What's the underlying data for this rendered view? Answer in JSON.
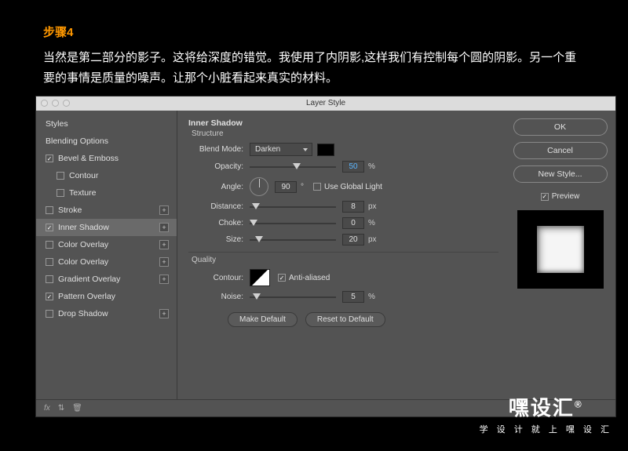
{
  "header": {
    "step_title": "步骤4",
    "description": "当然是第二部分的影子。这将给深度的错觉。我使用了内阴影,这样我们有控制每个圆的阴影。另一个重要的事情是质量的噪声。让那个小脏看起来真实的材料。"
  },
  "dialog": {
    "title": "Layer Style",
    "sidebar": {
      "styles": "Styles",
      "blending": "Blending Options",
      "bevel": "Bevel & Emboss",
      "contour": "Contour",
      "texture": "Texture",
      "stroke": "Stroke",
      "inner_shadow": "Inner Shadow",
      "color_overlay": "Color Overlay",
      "color_overlay2": "Color Overlay",
      "gradient_overlay": "Gradient Overlay",
      "pattern_overlay": "Pattern Overlay",
      "drop_shadow": "Drop Shadow"
    },
    "main": {
      "section": "Inner Shadow",
      "structure": "Structure",
      "blend_mode_label": "Blend Mode:",
      "blend_mode_value": "Darken",
      "opacity_label": "Opacity:",
      "opacity_value": "50",
      "opacity_unit": "%",
      "angle_label": "Angle:",
      "angle_value": "90",
      "angle_unit": "°",
      "global_light": "Use Global Light",
      "distance_label": "Distance:",
      "distance_value": "8",
      "distance_unit": "px",
      "choke_label": "Choke:",
      "choke_value": "0",
      "choke_unit": "%",
      "size_label": "Size:",
      "size_value": "20",
      "size_unit": "px",
      "quality": "Quality",
      "contour_label": "Contour:",
      "anti_aliased": "Anti-aliased",
      "noise_label": "Noise:",
      "noise_value": "5",
      "noise_unit": "%",
      "make_default": "Make Default",
      "reset_default": "Reset to Default"
    },
    "right": {
      "ok": "OK",
      "cancel": "Cancel",
      "new_style": "New Style...",
      "preview": "Preview"
    },
    "footer": {
      "fx": "fx"
    }
  },
  "watermark": {
    "big": "嘿设汇",
    "small": "学 设 计 就 上 嘿 设 汇"
  }
}
